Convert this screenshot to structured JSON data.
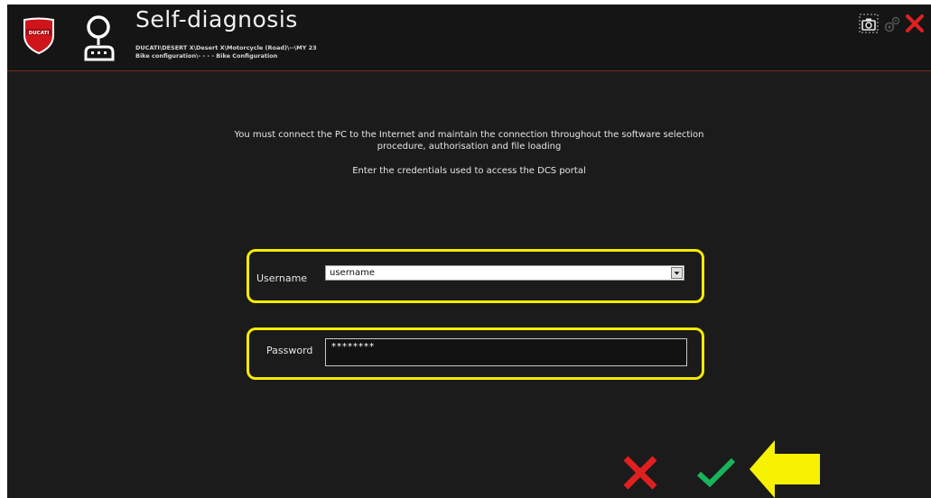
{
  "header": {
    "title": "Self-diagnosis",
    "breadcrumb_line1": "DUCATI\\DESERT X\\Desert X\\Motorcycle (Road)\\--\\MY 23",
    "breadcrumb_line2": "Bike configuration\\- - - - Bike Configuration",
    "logo_text": "DUCATI",
    "icons": {
      "logo": "ducati-shield-icon",
      "section": "self-diagnosis-icon",
      "screenshot": "camera-icon",
      "settings": "gears-icon",
      "close": "close-icon"
    }
  },
  "message": {
    "line1": "You must connect the PC to the Internet and maintain the connection throughout the software selection",
    "line2": "procedure, authorisation and file loading",
    "line3": "Enter the credentials used to access the DCS portal"
  },
  "form": {
    "username_label": "Username",
    "username_value": "username",
    "password_label": "Password",
    "password_value": "********"
  },
  "actions": {
    "cancel_icon": "red-x-icon",
    "confirm_icon": "green-check-icon"
  },
  "colors": {
    "background": "#1b1b1b",
    "highlight": "#f5ec00",
    "cancel": "#e02020",
    "confirm": "#19b35a",
    "brand_red": "#d0141c"
  }
}
